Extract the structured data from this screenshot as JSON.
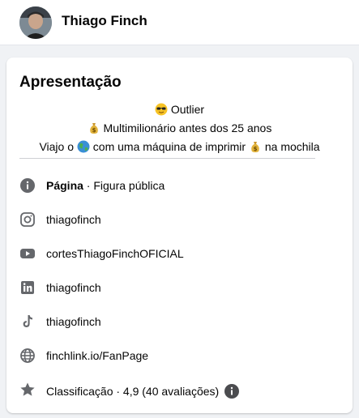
{
  "header": {
    "profile_name": "Thiago Finch"
  },
  "intro": {
    "title": "Apresentação",
    "bio": {
      "line1": "Outlier",
      "line2": "Multimilionário antes dos 25 anos",
      "line3_part1": "Viajo o",
      "line3_part2": "com uma máquina de imprimir",
      "line3_part3": "na mochila"
    },
    "items": [
      {
        "icon": "info-icon",
        "label_bold": "Página",
        "label_rest": " · Figura pública"
      },
      {
        "icon": "instagram-icon",
        "label": "thiagofinch"
      },
      {
        "icon": "youtube-icon",
        "label": "cortesThiagoFinchOFICIAL"
      },
      {
        "icon": "linkedin-icon",
        "label": "thiagofinch"
      },
      {
        "icon": "tiktok-icon",
        "label": "thiagofinch"
      },
      {
        "icon": "globe-icon",
        "label": "finchlink.io/FanPage"
      },
      {
        "icon": "star-icon",
        "label": "Classificação · 4,9 (40 avaliações)"
      }
    ]
  },
  "colors": {
    "link": "#216fdb",
    "icon_gray": "#65676b",
    "card_bg": "#ffffff",
    "page_bg": "#f0f2f5"
  }
}
